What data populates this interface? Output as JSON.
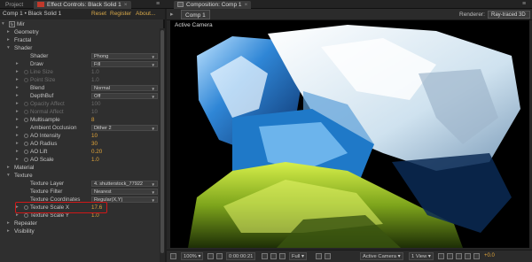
{
  "tabs": {
    "project": "Project",
    "effect_controls": "Effect Controls: Black Solid 1",
    "composition": "Composition: Comp 1"
  },
  "effect_panel": {
    "layer_path": "Comp 1 • Black Solid 1",
    "reset": "Reset",
    "register": "Register",
    "about": "About...",
    "rows": [
      {
        "indent": 0,
        "tri": "▾",
        "fx": true,
        "label": "Mir",
        "kind": "group",
        "dim": false
      },
      {
        "indent": 1,
        "tri": "▸",
        "label": "Geometry",
        "kind": "group",
        "dim": false
      },
      {
        "indent": 1,
        "tri": "▸",
        "label": "Fractal",
        "kind": "group",
        "dim": false
      },
      {
        "indent": 1,
        "tri": "▾",
        "label": "Shader",
        "kind": "group",
        "dim": false
      },
      {
        "indent": 2,
        "label": "Shader",
        "kind": "dropdown",
        "value": "Phong",
        "dim": false
      },
      {
        "indent": 2,
        "tri": "▸",
        "label": "Draw",
        "kind": "dropdown",
        "value": "Fill",
        "dim": false
      },
      {
        "indent": 2,
        "tri": "▸",
        "sw": true,
        "label": "Line Size",
        "kind": "value",
        "value": "1.0",
        "dim": true
      },
      {
        "indent": 2,
        "tri": "▸",
        "sw": true,
        "label": "Point Size",
        "kind": "value",
        "value": "1.0",
        "dim": true
      },
      {
        "indent": 2,
        "tri": "▸",
        "label": "Blend",
        "kind": "dropdown",
        "value": "Normal",
        "dim": false
      },
      {
        "indent": 2,
        "tri": "▸",
        "label": "DepthBuf",
        "kind": "dropdown",
        "value": "Off",
        "dim": false
      },
      {
        "indent": 2,
        "tri": "▸",
        "sw": true,
        "label": "Opacity Affect",
        "kind": "value",
        "value": "100",
        "dim": true
      },
      {
        "indent": 2,
        "tri": "▸",
        "sw": true,
        "label": "Normal Affect",
        "kind": "value",
        "value": "10",
        "dim": true
      },
      {
        "indent": 2,
        "tri": "▸",
        "sw": true,
        "label": "Multisample",
        "kind": "value",
        "value": "8",
        "dim": false
      },
      {
        "indent": 2,
        "tri": "▸",
        "label": "Ambient Occlusion",
        "kind": "dropdown",
        "value": "Dither 2",
        "dim": false
      },
      {
        "indent": 2,
        "tri": "▸",
        "sw": true,
        "label": "AO Intensity",
        "kind": "value",
        "value": "10",
        "dim": false
      },
      {
        "indent": 2,
        "tri": "▸",
        "sw": true,
        "label": "AO Radius",
        "kind": "value",
        "value": "30",
        "dim": false
      },
      {
        "indent": 2,
        "tri": "▸",
        "sw": true,
        "label": "AO Lift",
        "kind": "value",
        "value": "0.20",
        "dim": false
      },
      {
        "indent": 2,
        "tri": "▸",
        "sw": true,
        "label": "AO Scale",
        "kind": "value",
        "value": "1.0",
        "dim": false
      },
      {
        "indent": 1,
        "tri": "▸",
        "label": "Material",
        "kind": "group",
        "dim": false
      },
      {
        "indent": 1,
        "tri": "▾",
        "label": "Texture",
        "kind": "group",
        "dim": false
      },
      {
        "indent": 2,
        "label": "Texture Layer",
        "kind": "dropdown",
        "value": "4. shutterstock_77922",
        "dim": false
      },
      {
        "indent": 2,
        "label": "Texture Filter",
        "kind": "dropdown",
        "value": "Nearest",
        "dim": false
      },
      {
        "indent": 2,
        "label": "Texture Coordinates",
        "kind": "dropdown",
        "value": "Regular(X,Y)",
        "dim": false
      },
      {
        "indent": 2,
        "tri": "▸",
        "sw": true,
        "label": "Texture Scale X",
        "kind": "value",
        "value": "17.6",
        "dim": false
      },
      {
        "indent": 2,
        "tri": "▸",
        "sw": true,
        "label": "Texture Scale Y",
        "kind": "value",
        "value": "1.0",
        "dim": false
      },
      {
        "indent": 1,
        "tri": "▸",
        "label": "Repeater",
        "kind": "group",
        "dim": false
      },
      {
        "indent": 1,
        "tri": "▸",
        "label": "Visibility",
        "kind": "group",
        "dim": false
      }
    ]
  },
  "composition_panel": {
    "tab": "Comp 1",
    "renderer_label": "Renderer:",
    "renderer_value": "Ray-traced 3D",
    "viewer_label": "Active Camera",
    "footer": {
      "zoom": "100%",
      "timecode": "0:00:00:21",
      "resolution": "Full",
      "view": "Active Camera",
      "views": "1 View",
      "exposure": "+0.0"
    }
  },
  "colors": {
    "accent_value": "#e0a43a",
    "highlight_box": "#d01818",
    "panel_bg": "#2f2f2f"
  }
}
